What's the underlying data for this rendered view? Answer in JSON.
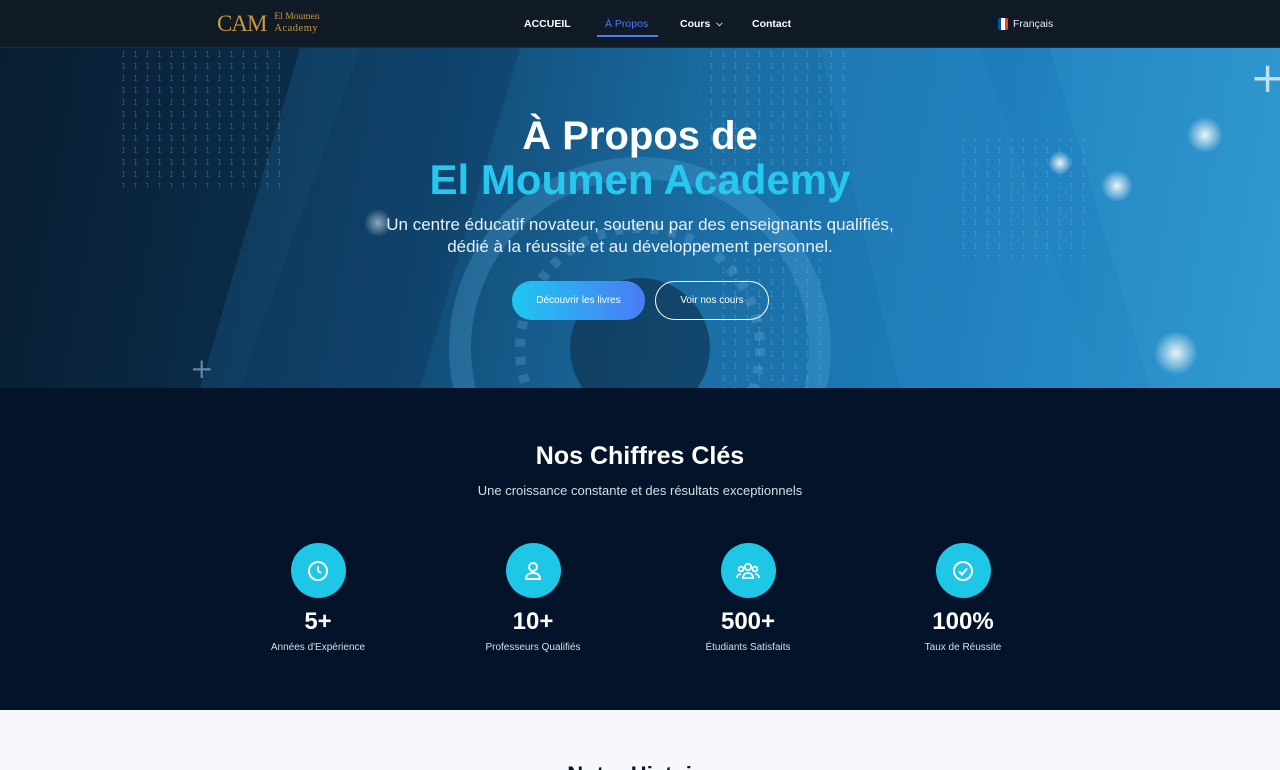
{
  "nav": {
    "logo_mark": "CAM",
    "logo_line1": "El Moumen",
    "logo_line2": "Academy",
    "links": [
      {
        "label": "ACCUEIL"
      },
      {
        "label": "À Propos"
      },
      {
        "label": "Cours"
      },
      {
        "label": "Contact"
      }
    ],
    "language": "Français",
    "accent_color": "#4e7cf5"
  },
  "hero": {
    "title_line1": "À Propos de",
    "title_line2": "El Moumen Academy",
    "subtitle": "Un centre éducatif novateur, soutenu par des enseignants qualifiés, dédié à la réussite et au développement personnel.",
    "primary_button": "Découvrir les livres",
    "secondary_button": "Voir nos cours",
    "highlight_color": "#27c8ef"
  },
  "stats": {
    "title": "Nos Chiffres Clés",
    "subtitle": "Une croissance constante et des résultats exceptionnels",
    "items": [
      {
        "icon": "clock-icon",
        "value": "5+",
        "label": "Années d'Expérience"
      },
      {
        "icon": "user-icon",
        "value": "10+",
        "label": "Professeurs Qualifiés"
      },
      {
        "icon": "users-group-icon",
        "value": "500+",
        "label": "Étudiants Satisfaits"
      },
      {
        "icon": "check-circle-icon",
        "value": "100%",
        "label": "Taux de Réussite"
      }
    ],
    "icon_color": "#1fc7e6"
  },
  "next_section": {
    "title": "Notre Histoire"
  }
}
